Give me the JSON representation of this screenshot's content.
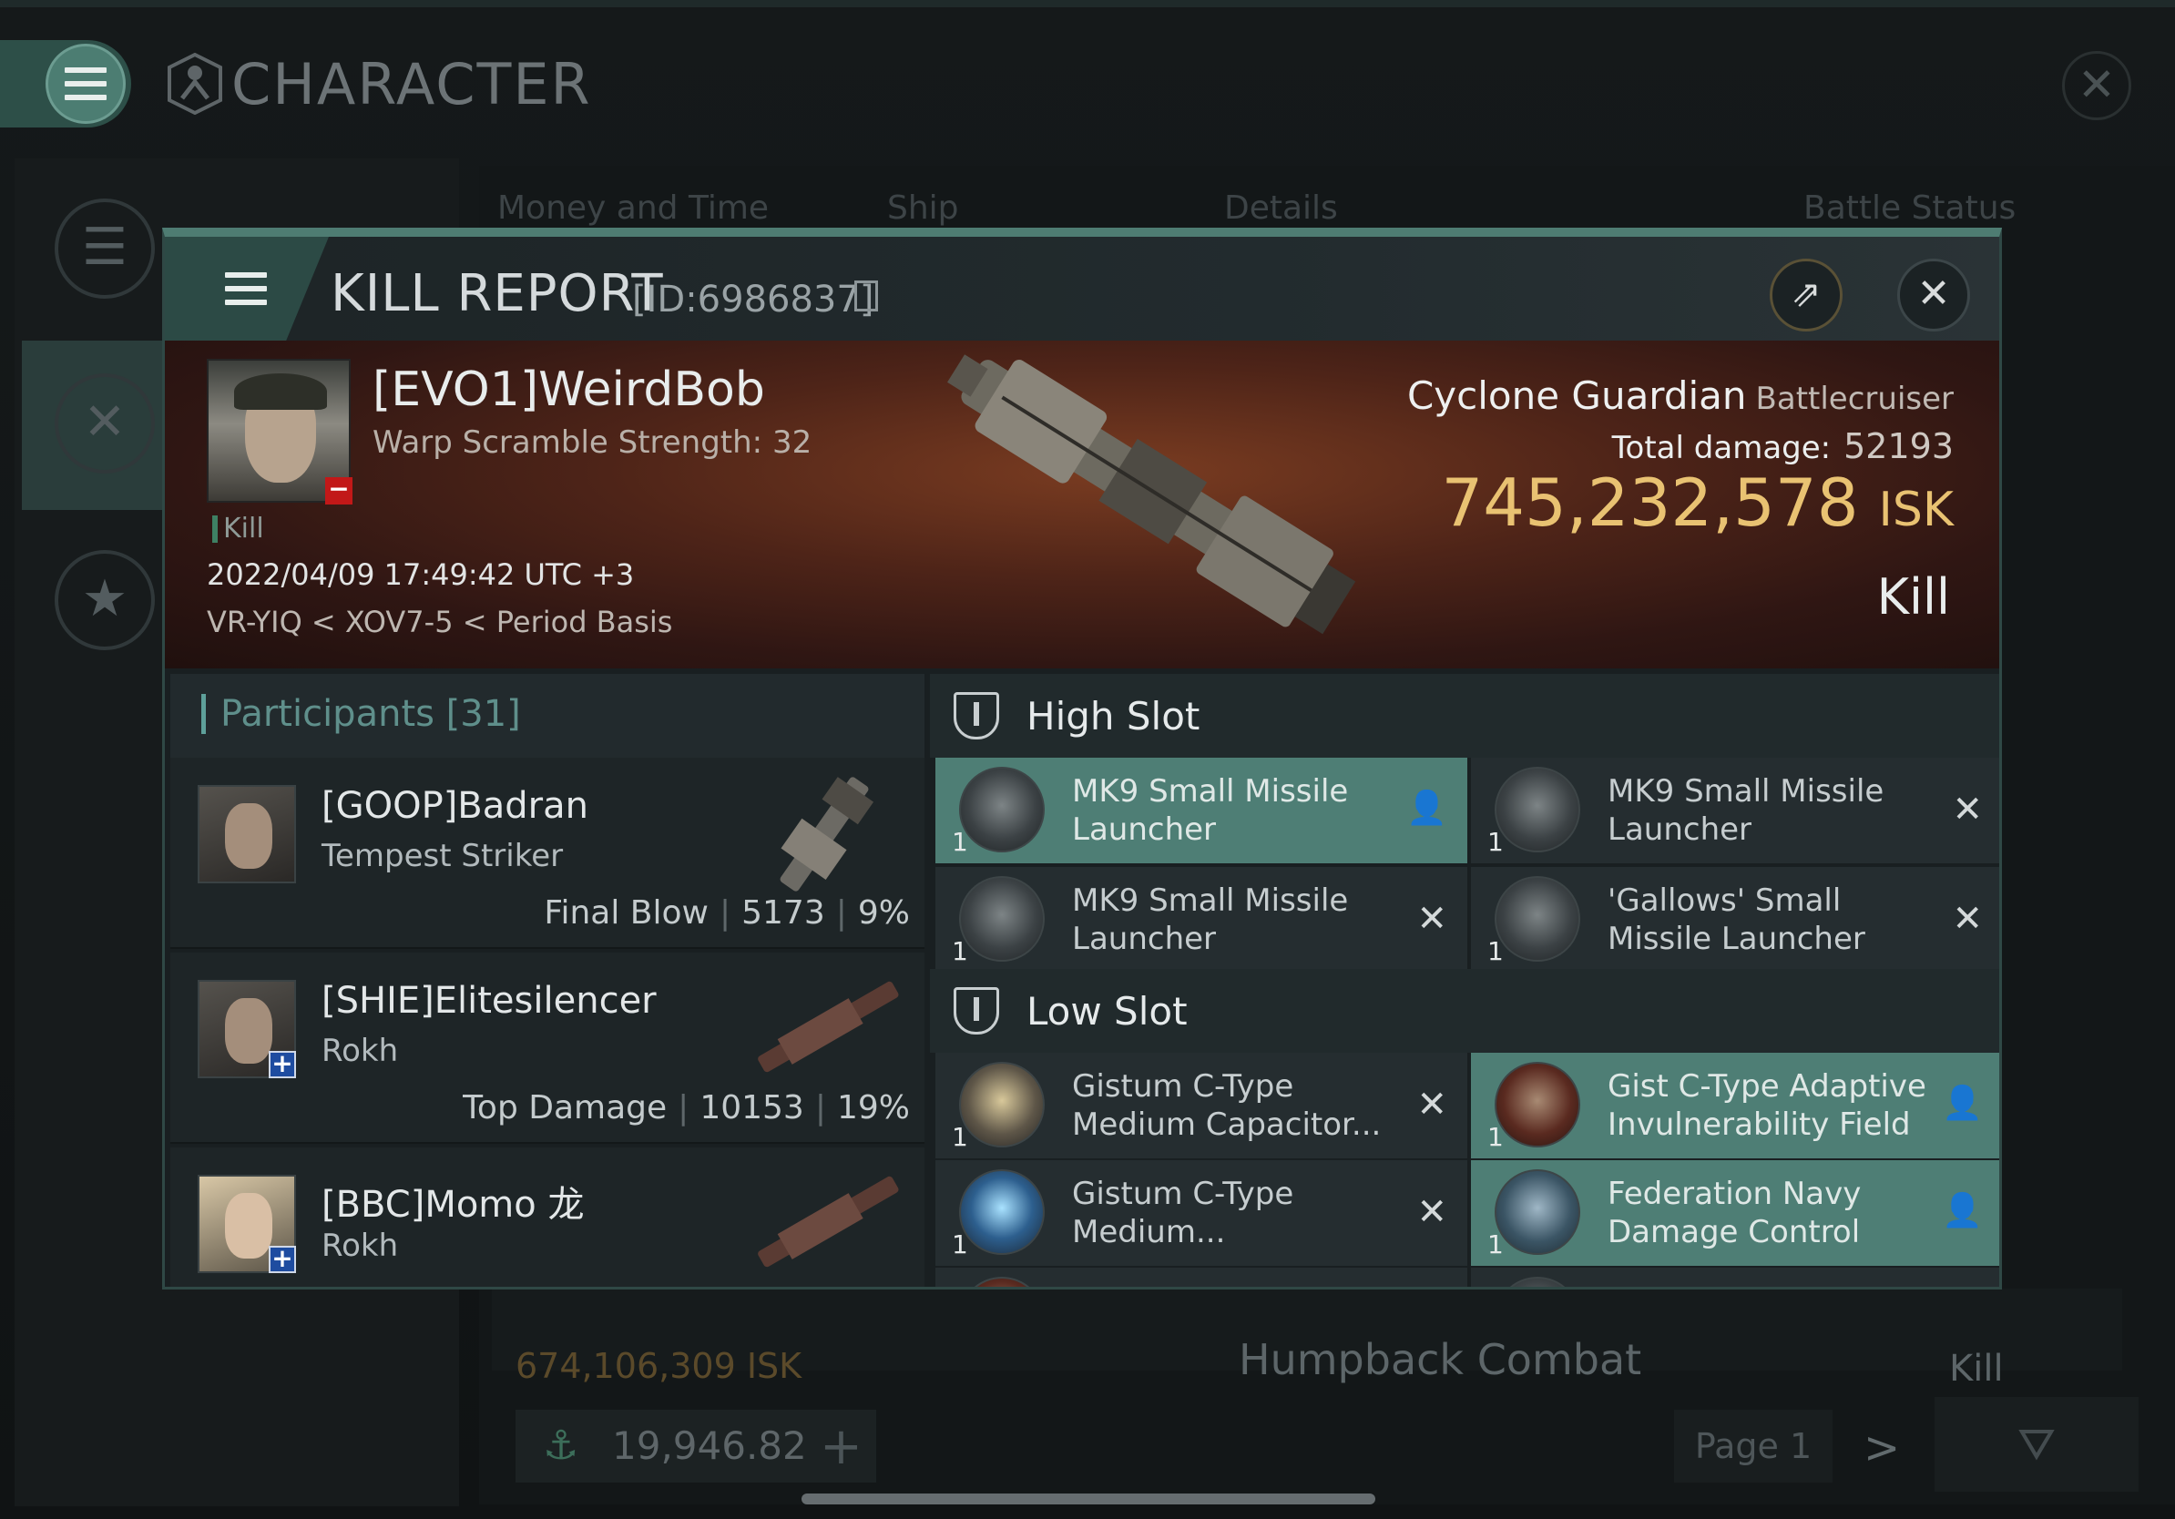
{
  "background": {
    "window_title": "CHARACTER",
    "columns": [
      "Money and Time",
      "Ship",
      "Details",
      "Battle Status"
    ],
    "row": {
      "isk": "674,106,309  ISK",
      "ship": "Humpback Combat",
      "status": "Kill"
    },
    "wallet_value": "19,946.82",
    "page_label": "Page 1"
  },
  "kill_report": {
    "title": "KILL REPORT",
    "id": "[ID:6986837]",
    "victim": {
      "name": "[EVO1]WeirdBob",
      "detail": "Warp Scramble Strength: 32",
      "tag": "Kill",
      "time": "2022/04/09 17:49:42 UTC +3",
      "location": "VR-YIQ < XOV7-5 < Period Basis"
    },
    "ship": {
      "name": "Cyclone Guardian",
      "class": "Battlecruiser",
      "damage_label": "Total damage:",
      "damage_value": "52193",
      "isk_value": "745,232,578",
      "isk_unit": "ISK",
      "result": "Kill"
    },
    "participants": {
      "header": "Participants [31]",
      "items": [
        {
          "name": "[GOOP]Badran",
          "ship": "Tempest Striker",
          "label": "Final Blow",
          "damage": "5173",
          "percent": "9%"
        },
        {
          "name": "[SHIE]Elitesilencer",
          "ship": "Rokh",
          "label": "Top Damage",
          "damage": "10153",
          "percent": "19%"
        },
        {
          "name": "[BBC]Momo 龙",
          "ship": "Rokh",
          "label": "",
          "damage": "",
          "percent": ""
        }
      ]
    },
    "fitting": {
      "high_slot": {
        "title": "High Slot",
        "modules": [
          {
            "qty": "1",
            "name": "MK9 Small Missile Launcher",
            "status": "dropped"
          },
          {
            "qty": "1",
            "name": "MK9 Small Missile Launcher",
            "status": "destroyed"
          },
          {
            "qty": "1",
            "name": "MK9 Small Missile Launcher",
            "status": "destroyed"
          },
          {
            "qty": "1",
            "name": "'Gallows' Small Missile Launcher",
            "status": "destroyed"
          }
        ]
      },
      "low_slot": {
        "title": "Low Slot",
        "modules": [
          {
            "qty": "1",
            "name": "Gistum C-Type Medium Capacitor...",
            "status": "destroyed"
          },
          {
            "qty": "1",
            "name": "Gist C-Type Adaptive Invulnerability Field",
            "status": "dropped"
          },
          {
            "qty": "1",
            "name": "Gistum C-Type Medium...",
            "status": "destroyed"
          },
          {
            "qty": "1",
            "name": "Federation Navy Damage Control",
            "status": "dropped"
          }
        ]
      }
    }
  },
  "icons": {
    "menu": "hamburger-icon",
    "share": "share-icon",
    "close": "close-icon",
    "dropped": "person-icon",
    "destroyed": "x-icon"
  },
  "colors": {
    "accent": "#4e7e75",
    "isk": "#e9c272",
    "kill_tag": "#3e8063"
  }
}
